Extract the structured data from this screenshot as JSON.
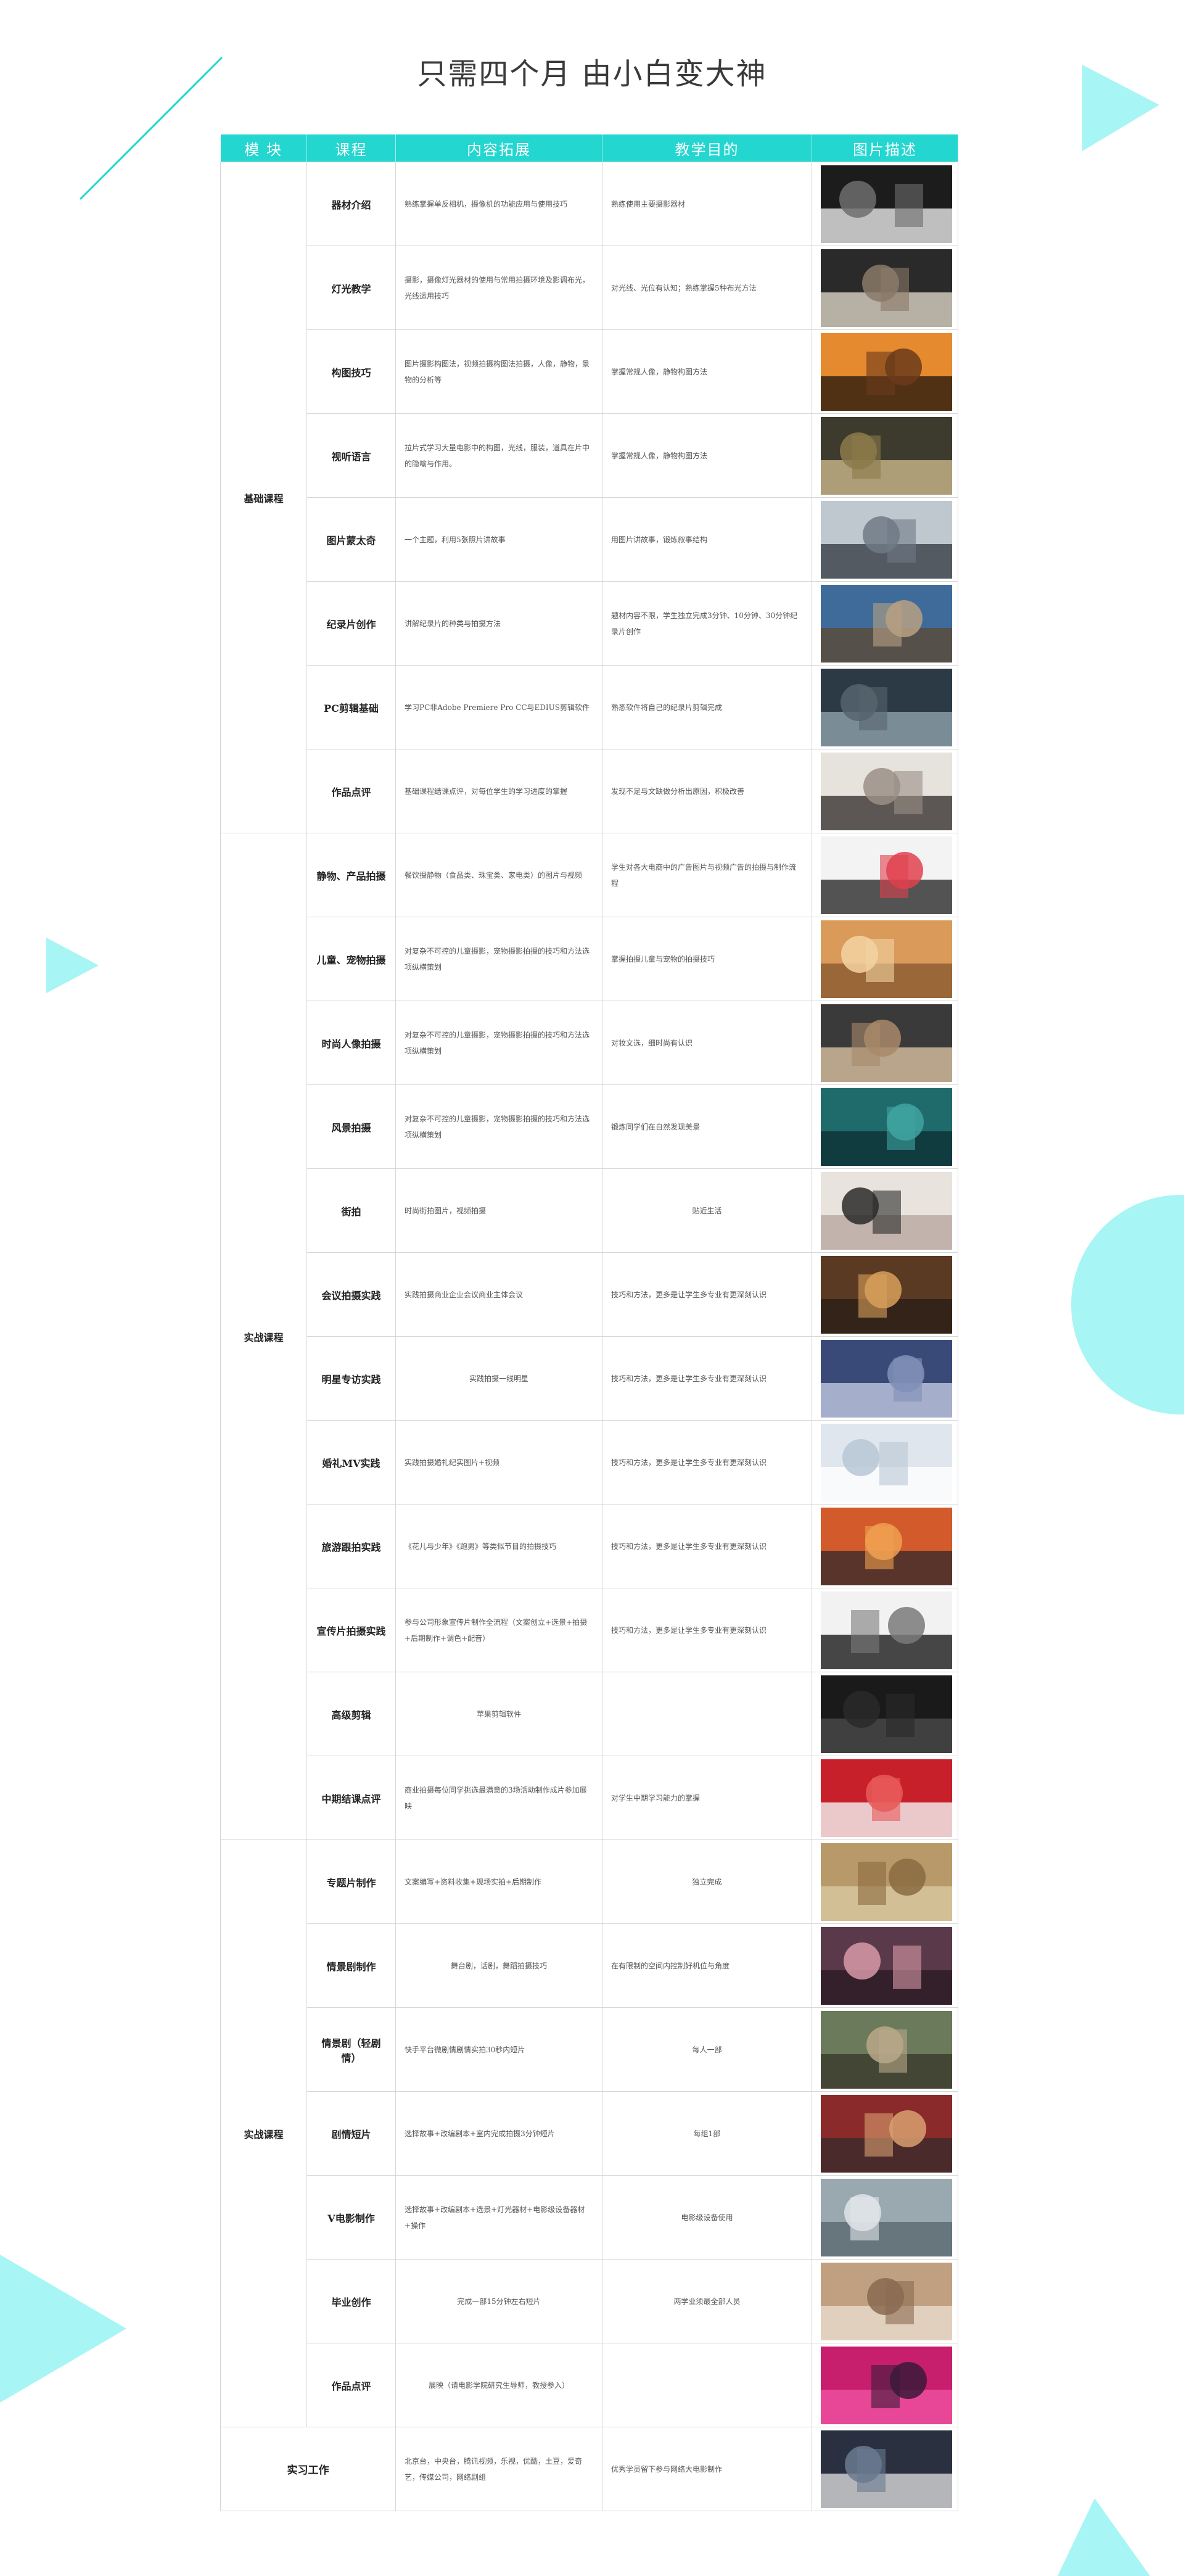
{
  "title": "只需四个月 由小白变大神",
  "headers": [
    "模  块",
    "课程",
    "内容拓展",
    "教学目的",
    "图片描述"
  ],
  "modules": {
    "basic": "基础课程",
    "practice": "实战课程",
    "practice2": "实战课程",
    "intern": "实习工作"
  },
  "rows": [
    {
      "course": "器材介绍",
      "content": "熟练掌握单反相机，摄像机的功能应用与使用技巧",
      "goal": "熟练使用主要摄影器材",
      "thumb": "camera-gear-photo"
    },
    {
      "course": "灯光教学",
      "content": "摄影，摄像灯光器材的使用与常用拍摄环境及影调布光，光线运用技巧",
      "goal": "对光线、光位有认知；熟练掌握5种布光方法",
      "thumb": "studio-lighting-photo"
    },
    {
      "course": "构图技巧",
      "content": "图片摄影构图法，视频拍摄构图法拍摄，人像，静物，景物的分析等",
      "goal": "掌握常规人像，静物构图方法",
      "thumb": "sunset-tree-photo"
    },
    {
      "course": "视听语言",
      "content": "拉片式学习大量电影中的构图，光线，服装，道具在片中的隐喻与作用。",
      "goal": "掌握常规人像，静物构图方法",
      "thumb": "film-still-photo"
    },
    {
      "course": "图片蒙太奇",
      "content": "一个主题，利用5张照片讲故事",
      "goal": "用图片讲故事，锻炼叙事结构",
      "thumb": "horse-montage-photo"
    },
    {
      "course": "纪录片创作",
      "content": "讲解纪录片的种类与拍摄方法",
      "goal": "题材内容不限，学生独立完成3分钟、10分钟、30分钟纪录片创作",
      "thumb": "mountain-landscape-photo"
    },
    {
      "course": "PC剪辑基础",
      "content": "学习PC非Adobe Premiere Pro CC与EDIUS剪辑软件",
      "goal": "熟悉软件将自己的纪录片剪辑完成",
      "thumb": "editing-software-photo"
    },
    {
      "course": "作品点评",
      "content": "基础课程结课点评，对每位学生的学习进度的掌握",
      "goal": "发现不足与文缺做分析出原因，积极改善",
      "thumb": "group-portrait-photo"
    },
    {
      "course": "静物、产品拍摄",
      "content": "餐饮摄静物（食品类、珠宝类、家电类）的图片与视频",
      "goal": "学生对各大电商中的广告图片与视频广告的拍摄与制作流程",
      "thumb": "handbags-photo"
    },
    {
      "course": "儿童、宠物拍摄",
      "content": "对复杂不可控的儿童摄影，宠物摄影拍摄的技巧和方法选项纵横策划",
      "goal": "掌握拍摄儿童与宠物的拍摄技巧",
      "thumb": "child-portrait-photo"
    },
    {
      "course": "时尚人像拍摄",
      "content": "对复杂不可控的儿童摄影，宠物摄影拍摄的技巧和方法选项纵横策划",
      "goal": "对妆文选，细时尚有认识",
      "thumb": "fashion-portrait-photo"
    },
    {
      "course": "风景拍摄",
      "content": "对复杂不可控的儿童摄影，宠物摄影拍摄的技巧和方法选项纵横策划",
      "goal": "锻炼同学们在自然发现美景",
      "thumb": "fantasy-landscape-photo"
    },
    {
      "course": "街拍",
      "content": "时尚街拍图片，视频拍摄",
      "goal": "贴近生活",
      "goal_center": true,
      "thumb": "street-fashion-photo"
    },
    {
      "course": "会议拍摄实践",
      "content": "实践拍摄商业企业会议商业主体会议",
      "goal": "技巧和方法，更多是让学生多专业有更深刻认识",
      "thumb": "conference-photo"
    },
    {
      "course": "明星专访实践",
      "content": "实践拍摄一线明星",
      "content_center": true,
      "goal": "技巧和方法，更多是让学生多专业有更深刻认识",
      "thumb": "celebrity-interview-photo"
    },
    {
      "course": "婚礼MV实践",
      "content": "实践拍摄婚礼纪实图片+视频",
      "goal": "技巧和方法，更多是让学生多专业有更深刻认识",
      "thumb": "wedding-photo"
    },
    {
      "course": "旅游跟拍实践",
      "content": "《花儿与少年》《跑男》等类似节目的拍摄技巧",
      "goal": "技巧和方法，更多是让学生多专业有更深刻认识",
      "thumb": "travel-photo"
    },
    {
      "course": "宣传片拍摄实践",
      "content": "参与公司形象宣传片制作全流程（文案创立+选景+拍摄+后期制作+调色+配音）",
      "goal": "技巧和方法，更多是让学生多专业有更深刻认识",
      "thumb": "promo-film-photo"
    },
    {
      "course": "高级剪辑",
      "content": "苹果剪辑软件",
      "content_center": true,
      "goal": "",
      "thumb": "advanced-editing-photo"
    },
    {
      "course": "中期结课点评",
      "content": "商业拍摄每位同学挑选最满意的3场活动制作成片参加展映",
      "goal": "对学生中期学习能力的掌握",
      "thumb": "mid-review-photo"
    },
    {
      "course": "专题片制作",
      "content": "文案编写+资料收集+现场实拍+后期制作",
      "goal": "独立完成",
      "goal_center": true,
      "thumb": "documentary-photo"
    },
    {
      "course": "情景剧制作",
      "content": "舞台剧，话剧，舞蹈拍摄技巧",
      "content_center": true,
      "goal": "在有限制的空间内控制好机位与角度",
      "thumb": "drama-scene-photo"
    },
    {
      "course": "情景剧（轻剧情）",
      "content": "快手平台微剧情剧情实拍30秒内短片",
      "goal": "每人一部",
      "goal_center": true,
      "thumb": "light-drama-photo"
    },
    {
      "course": "剧情短片",
      "content": "选择故事+改编剧本+室内完成拍摄3分钟短片",
      "goal": "每组1部",
      "goal_center": true,
      "thumb": "short-film-photo"
    },
    {
      "course": "V电影制作",
      "content": "选择故事+改编剧本+选景+灯光器材+电影级设备器材+操作",
      "goal": "电影级设备使用",
      "goal_center": true,
      "thumb": "v-movie-photo"
    },
    {
      "course": "毕业创作",
      "content": "完成一部15分钟左右短片",
      "content_center": true,
      "goal": "两学业须最全部人员",
      "goal_center": true,
      "thumb": "graduation-film-photo"
    },
    {
      "course": "作品点评",
      "content": "展映（请电影学院研究生导师，教授参入）",
      "content_center": true,
      "goal": "",
      "thumb": "screening-photo"
    }
  ],
  "intern_row": {
    "content": "北京台，中央台，腾讯视频，乐视，优酷，土豆，爱奇艺，传媒公司，网络剧组",
    "goal": "优秀学员留下参与网络大电影制作",
    "thumb": "internship-photo"
  },
  "colors": {
    "accent": "#23d6d0",
    "decor": "#a8f5f5"
  }
}
